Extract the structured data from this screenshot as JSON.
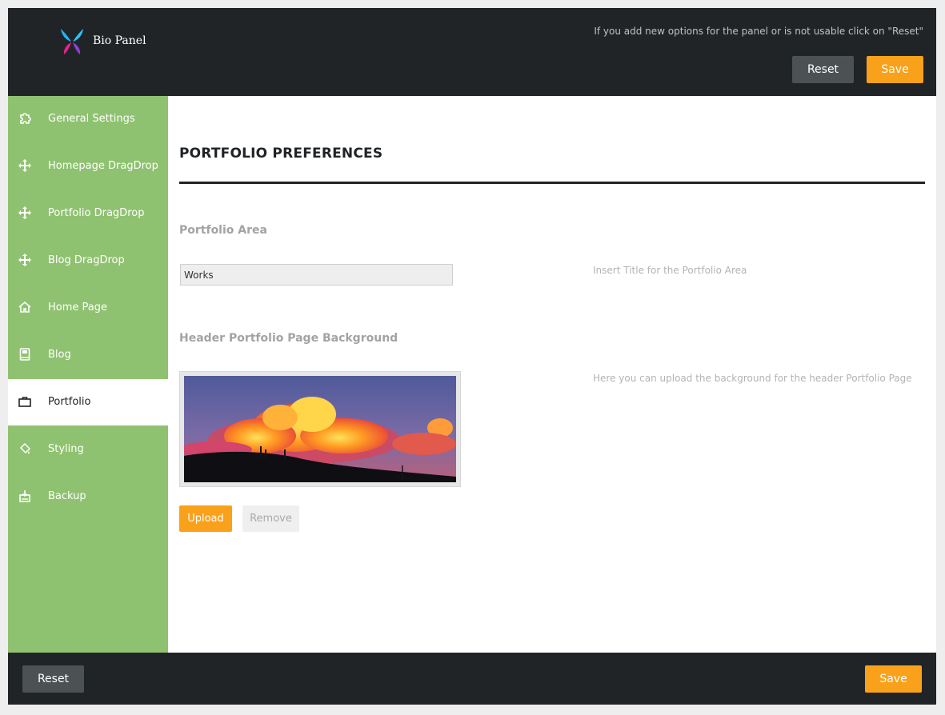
{
  "header": {
    "brand": "Bio Panel",
    "notice": "If you add new options for the panel or is not usable click on \"Reset\"",
    "reset_label": "Reset",
    "save_label": "Save"
  },
  "sidebar": {
    "items": [
      {
        "label": "General Settings",
        "icon": "puzzle-icon"
      },
      {
        "label": "Homepage DragDrop",
        "icon": "move-icon"
      },
      {
        "label": "Portfolio DragDrop",
        "icon": "move-icon"
      },
      {
        "label": "Blog DragDrop",
        "icon": "move-icon"
      },
      {
        "label": "Home Page",
        "icon": "home-icon"
      },
      {
        "label": "Blog",
        "icon": "book-icon"
      },
      {
        "label": "Portfolio",
        "icon": "briefcase-icon",
        "active": true
      },
      {
        "label": "Styling",
        "icon": "paint-bucket-icon"
      },
      {
        "label": "Backup",
        "icon": "backup-icon"
      }
    ]
  },
  "main": {
    "title": "PORTFOLIO PREFERENCES",
    "portfolio_area": {
      "label": "Portfolio Area",
      "value": "Works",
      "help": "Insert Title for the Portfolio Area"
    },
    "header_background": {
      "label": "Header Portfolio Page Background",
      "help": "Here you can upload the background for the header Portfolio Page",
      "upload_label": "Upload",
      "remove_label": "Remove"
    }
  },
  "footer": {
    "reset_label": "Reset",
    "save_label": "Save"
  },
  "colors": {
    "topbar": "#212427",
    "sidebar": "#8fc270",
    "accent": "#f9a11b",
    "reset_button": "#4c5154"
  }
}
